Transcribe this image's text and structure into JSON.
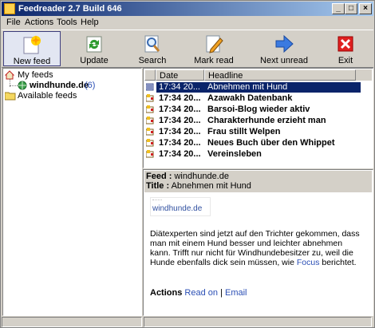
{
  "window": {
    "title": "Feedreader 2.7 Build 646",
    "buttons": [
      "_",
      "□",
      "×"
    ]
  },
  "menu": [
    "File",
    "Actions",
    "Tools",
    "Help"
  ],
  "toolbar": [
    {
      "label": "New feed",
      "icon": "new-feed-icon"
    },
    {
      "label": "Update",
      "icon": "update-icon"
    },
    {
      "label": "Search",
      "icon": "search-icon"
    },
    {
      "label": "Mark read",
      "icon": "mark-read-icon"
    },
    {
      "label": "Next unread",
      "icon": "next-unread-icon"
    },
    {
      "label": "Exit",
      "icon": "exit-icon"
    }
  ],
  "tree": {
    "my_feeds": "My feeds",
    "feed_name": "windhunde.de",
    "feed_count": "(6)",
    "available": "Available feeds"
  },
  "list": {
    "columns": [
      "Date",
      "Headline"
    ],
    "rows": [
      {
        "date": "17:34 20...",
        "headline": "Abnehmen mit Hund"
      },
      {
        "date": "17:34 20...",
        "headline": "Azawakh Datenbank"
      },
      {
        "date": "17:34 20...",
        "headline": "Barsoi-Blog wieder aktiv"
      },
      {
        "date": "17:34 20...",
        "headline": "Charakterhunde erzieht man"
      },
      {
        "date": "17:34 20...",
        "headline": "Frau stillt Welpen"
      },
      {
        "date": "17:34 20...",
        "headline": "Neues Buch über den Whippet"
      },
      {
        "date": "17:34 20...",
        "headline": "Vereinsleben"
      }
    ]
  },
  "preview": {
    "feed_label": "Feed :",
    "feed_value": "windhunde.de",
    "title_label": "Title :",
    "title_value": "Abnehmen mit Hund",
    "logo_text": "windhunde.de",
    "body_1": "Diätexperten sind jetzt auf den Trichter gekommen, dass",
    "body_2": "man mit einem Hund besser und leichter abnehmen",
    "body_3": "kann. Trifft nur nicht für Windhundebesitzer zu, weil die",
    "body_4_pre": "Hunde ebenfalls dick sein müssen, wie",
    "body_4_link": "Focus",
    "body_4_post": "berichtet.",
    "actions_label": "Actions",
    "read_on": "Read on",
    "sep": "|",
    "email": "Email"
  },
  "colors": {
    "selection": "#0a246a",
    "link": "#2b4fb5",
    "count": "#2b4fb5"
  }
}
